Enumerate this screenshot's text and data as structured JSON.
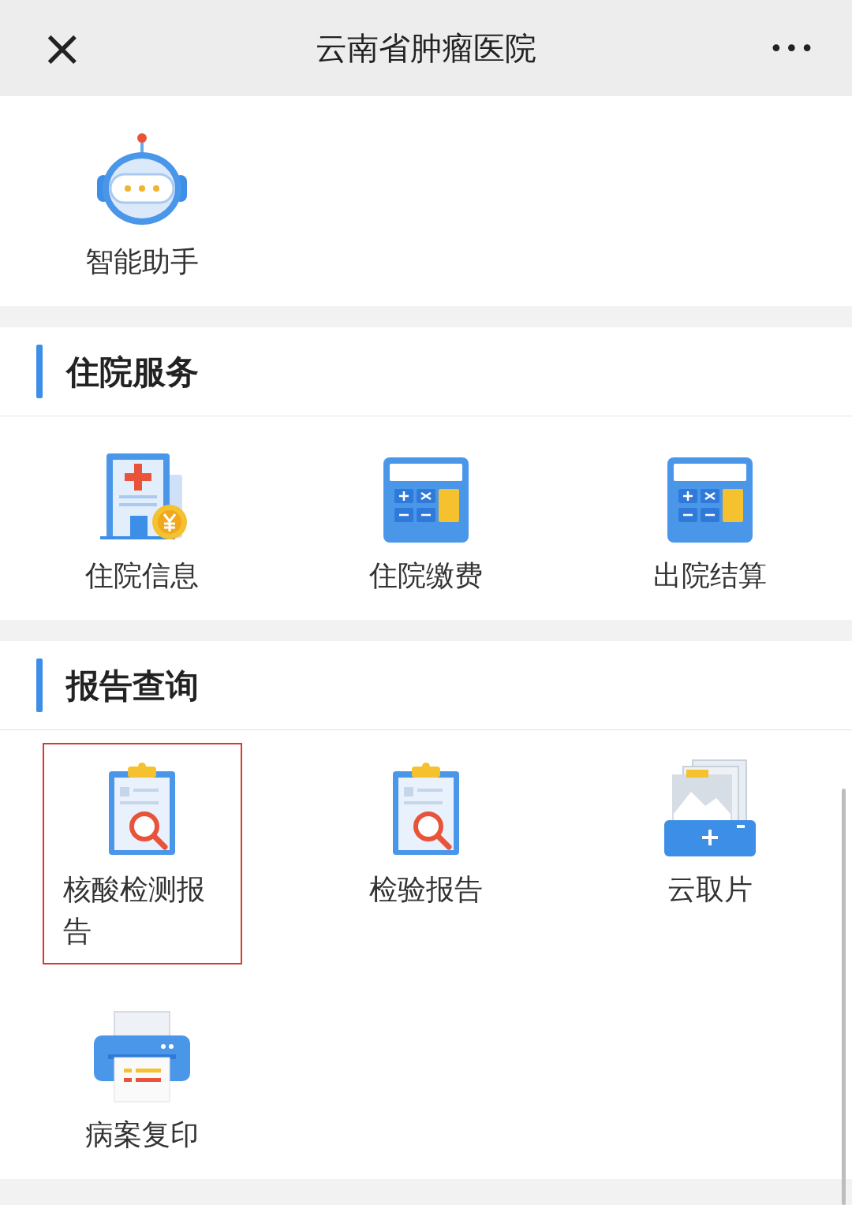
{
  "header": {
    "close": "×",
    "title": "云南省肿瘤医院",
    "more": "•••"
  },
  "top_items": [
    {
      "kind": "robot",
      "label": "智能助手",
      "highlighted": false
    }
  ],
  "sections": [
    {
      "title": "住院服务",
      "items": [
        {
          "kind": "hospital",
          "label": "住院信息",
          "highlighted": false
        },
        {
          "kind": "calculator",
          "label": "住院缴费",
          "highlighted": false
        },
        {
          "kind": "calculator",
          "label": "出院结算",
          "highlighted": false
        }
      ]
    },
    {
      "title": "报告查询",
      "items": [
        {
          "kind": "clipboard",
          "label": "核酸检测报告",
          "highlighted": true
        },
        {
          "kind": "clipboard",
          "label": "检验报告",
          "highlighted": false
        },
        {
          "kind": "images",
          "label": "云取片",
          "highlighted": false
        },
        {
          "kind": "printer",
          "label": "病案复印",
          "highlighted": false
        }
      ]
    }
  ]
}
